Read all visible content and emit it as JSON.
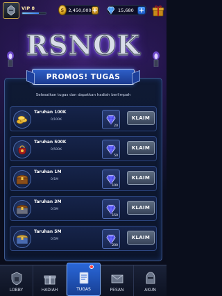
{
  "header": {
    "vip_label": "VIP 8",
    "vip_progress": 0.7,
    "coins": "2,450,000",
    "gems": "15,680"
  },
  "logo_text": "RSNOK",
  "banner_title": "PROMOS! TUGAS",
  "subtitle": "Selesaikan tugas dan dapatkan hadiah berlimpah",
  "tasks": [
    {
      "title": "Taruhan 100K",
      "progress": "0/100K",
      "reward": "20",
      "claim": "KLAIM",
      "icon": "gold-coins-icon"
    },
    {
      "title": "Taruhan 500K",
      "progress": "0/500K",
      "reward": "50",
      "claim": "KLAIM",
      "icon": "gift-bag-icon"
    },
    {
      "title": "Taruhan 1M",
      "progress": "0/1M",
      "reward": "100",
      "claim": "KLAIM",
      "icon": "treasure-chest-icon"
    },
    {
      "title": "Taruhan 3M",
      "progress": "0/3M",
      "reward": "150",
      "claim": "KLAIM",
      "icon": "treasure-chest-icon"
    },
    {
      "title": "Taruhan 5M",
      "progress": "0/5M",
      "reward": "200",
      "claim": "KLAIM",
      "icon": "treasure-chest-icon"
    }
  ],
  "nav": {
    "lobby": "LOBBY",
    "hadiah": "HADIAH",
    "tugas": "TUGAS",
    "pesan": "PESAN",
    "akun": "AKUN"
  },
  "colors": {
    "accent_blue": "#2a67d8",
    "gold": "#d4a017",
    "claim_gray": "#5d6b80"
  }
}
